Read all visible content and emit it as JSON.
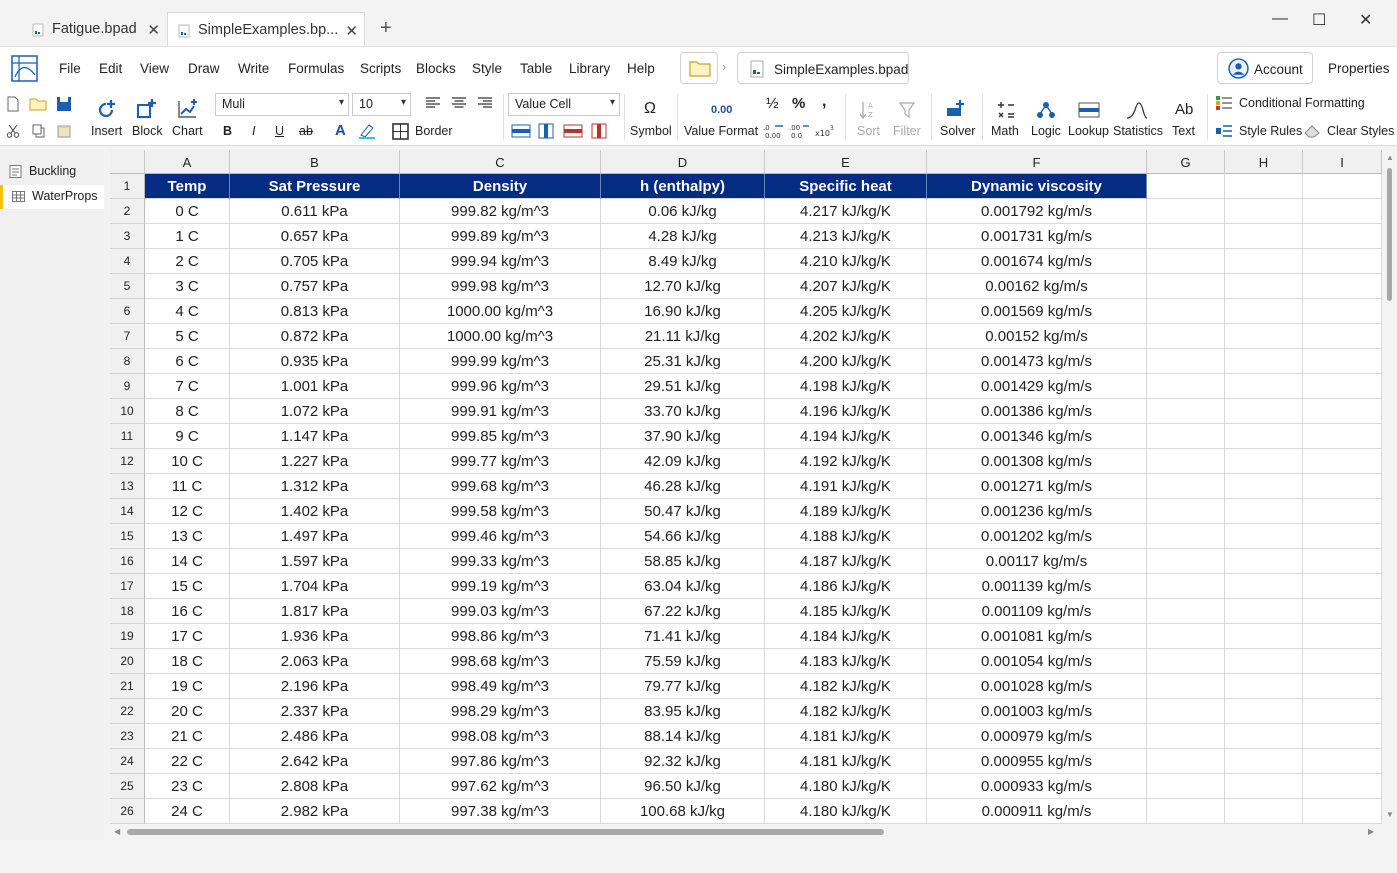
{
  "tabs": [
    {
      "label": "Fatigue.bpad"
    },
    {
      "label": "SimpleExamples.bp..."
    }
  ],
  "menu": [
    "File",
    "Edit",
    "View",
    "Draw",
    "Write",
    "Formulas",
    "Scripts",
    "Blocks",
    "Style",
    "Table",
    "Library",
    "Help"
  ],
  "file_chip": "SimpleExamples.bpad",
  "account_label": "Account",
  "properties_label": "Properties",
  "ribbon": {
    "insert": "Insert",
    "block": "Block",
    "chart": "Chart",
    "font": "Muli",
    "size": "10",
    "bold": "B",
    "italic": "I",
    "underline": "U",
    "strike": "ab",
    "font_color": "A",
    "border": "Border",
    "cell_type": "Value Cell",
    "symbol_glyph": "Ω",
    "symbol": "Symbol",
    "value_format_glyph": "0.00",
    "value_format": "Value Format",
    "fraction": "½",
    "percent": "%",
    "comma": ",",
    "sort": "Sort",
    "filter": "Filter",
    "solver": "Solver",
    "math": "Math",
    "logic": "Logic",
    "lookup": "Lookup",
    "statistics": "Statistics",
    "text_glyph": "Ab",
    "text": "Text",
    "conditional_formatting": "Conditional Formatting",
    "style_rules": "Style Rules",
    "clear_styles": "Clear Styles"
  },
  "sidebar": [
    {
      "label": "Buckling"
    },
    {
      "label": "WaterProps"
    }
  ],
  "grid": {
    "columns": [
      "A",
      "B",
      "C",
      "D",
      "E",
      "F",
      "G",
      "H",
      "I"
    ],
    "header": [
      "Temp",
      "Sat Pressure",
      "Density",
      "h (enthalpy)",
      "Specific heat",
      "Dynamic viscosity"
    ],
    "rows": [
      [
        "0 C",
        "0.611 kPa",
        "999.82 kg/m^3",
        "0.06 kJ/kg",
        "4.217 kJ/kg/K",
        "0.001792 kg/m/s"
      ],
      [
        "1 C",
        "0.657 kPa",
        "999.89 kg/m^3",
        "4.28 kJ/kg",
        "4.213 kJ/kg/K",
        "0.001731 kg/m/s"
      ],
      [
        "2 C",
        "0.705 kPa",
        "999.94 kg/m^3",
        "8.49 kJ/kg",
        "4.210 kJ/kg/K",
        "0.001674 kg/m/s"
      ],
      [
        "3 C",
        "0.757 kPa",
        "999.98 kg/m^3",
        "12.70 kJ/kg",
        "4.207 kJ/kg/K",
        "0.00162 kg/m/s"
      ],
      [
        "4 C",
        "0.813 kPa",
        "1000.00 kg/m^3",
        "16.90 kJ/kg",
        "4.205 kJ/kg/K",
        "0.001569 kg/m/s"
      ],
      [
        "5 C",
        "0.872 kPa",
        "1000.00 kg/m^3",
        "21.11 kJ/kg",
        "4.202 kJ/kg/K",
        "0.00152 kg/m/s"
      ],
      [
        "6 C",
        "0.935 kPa",
        "999.99 kg/m^3",
        "25.31 kJ/kg",
        "4.200 kJ/kg/K",
        "0.001473 kg/m/s"
      ],
      [
        "7 C",
        "1.001 kPa",
        "999.96 kg/m^3",
        "29.51 kJ/kg",
        "4.198 kJ/kg/K",
        "0.001429 kg/m/s"
      ],
      [
        "8 C",
        "1.072 kPa",
        "999.91 kg/m^3",
        "33.70 kJ/kg",
        "4.196 kJ/kg/K",
        "0.001386 kg/m/s"
      ],
      [
        "9 C",
        "1.147 kPa",
        "999.85 kg/m^3",
        "37.90 kJ/kg",
        "4.194 kJ/kg/K",
        "0.001346 kg/m/s"
      ],
      [
        "10 C",
        "1.227 kPa",
        "999.77 kg/m^3",
        "42.09 kJ/kg",
        "4.192 kJ/kg/K",
        "0.001308 kg/m/s"
      ],
      [
        "11 C",
        "1.312 kPa",
        "999.68 kg/m^3",
        "46.28 kJ/kg",
        "4.191 kJ/kg/K",
        "0.001271 kg/m/s"
      ],
      [
        "12 C",
        "1.402 kPa",
        "999.58 kg/m^3",
        "50.47 kJ/kg",
        "4.189 kJ/kg/K",
        "0.001236 kg/m/s"
      ],
      [
        "13 C",
        "1.497 kPa",
        "999.46 kg/m^3",
        "54.66 kJ/kg",
        "4.188 kJ/kg/K",
        "0.001202 kg/m/s"
      ],
      [
        "14 C",
        "1.597 kPa",
        "999.33 kg/m^3",
        "58.85 kJ/kg",
        "4.187 kJ/kg/K",
        "0.00117 kg/m/s"
      ],
      [
        "15 C",
        "1.704 kPa",
        "999.19 kg/m^3",
        "63.04 kJ/kg",
        "4.186 kJ/kg/K",
        "0.001139 kg/m/s"
      ],
      [
        "16 C",
        "1.817 kPa",
        "999.03 kg/m^3",
        "67.22 kJ/kg",
        "4.185 kJ/kg/K",
        "0.001109 kg/m/s"
      ],
      [
        "17 C",
        "1.936 kPa",
        "998.86 kg/m^3",
        "71.41 kJ/kg",
        "4.184 kJ/kg/K",
        "0.001081 kg/m/s"
      ],
      [
        "18 C",
        "2.063 kPa",
        "998.68 kg/m^3",
        "75.59 kJ/kg",
        "4.183 kJ/kg/K",
        "0.001054 kg/m/s"
      ],
      [
        "19 C",
        "2.196 kPa",
        "998.49 kg/m^3",
        "79.77 kJ/kg",
        "4.182 kJ/kg/K",
        "0.001028 kg/m/s"
      ],
      [
        "20 C",
        "2.337 kPa",
        "998.29 kg/m^3",
        "83.95 kJ/kg",
        "4.182 kJ/kg/K",
        "0.001003 kg/m/s"
      ],
      [
        "21 C",
        "2.486 kPa",
        "998.08 kg/m^3",
        "88.14 kJ/kg",
        "4.181 kJ/kg/K",
        "0.000979 kg/m/s"
      ],
      [
        "22 C",
        "2.642 kPa",
        "997.86 kg/m^3",
        "92.32 kJ/kg",
        "4.181 kJ/kg/K",
        "0.000955 kg/m/s"
      ],
      [
        "23 C",
        "2.808 kPa",
        "997.62 kg/m^3",
        "96.50 kJ/kg",
        "4.180 kJ/kg/K",
        "0.000933 kg/m/s"
      ],
      [
        "24 C",
        "2.982 kPa",
        "997.38 kg/m^3",
        "100.68 kJ/kg",
        "4.180 kJ/kg/K",
        "0.000911 kg/m/s"
      ]
    ]
  },
  "colors": {
    "header_bg": "#062b83",
    "accent": "#1a5fb4",
    "sheet_marker": "#f1c40f"
  }
}
